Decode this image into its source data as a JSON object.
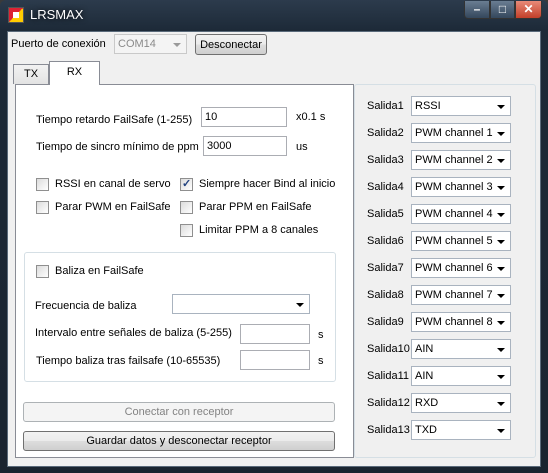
{
  "window": {
    "title": "LRSMAX"
  },
  "connection": {
    "port_label": "Puerto de conexión",
    "port_value": "COM14",
    "disconnect_label": "Desconectar"
  },
  "tabs": [
    {
      "label": "TX"
    },
    {
      "label": "RX"
    }
  ],
  "rx": {
    "failsafe_delay_label": "Tiempo retardo FailSafe (1-255)",
    "failsafe_delay_value": "10",
    "failsafe_delay_unit": "x0.1 s",
    "ppm_sync_label": "Tiempo de sincro mínimo de ppm",
    "ppm_sync_value": "3000",
    "ppm_sync_unit": "us",
    "checkboxes": {
      "rssi_servo": {
        "label": "RSSI en canal de servo",
        "checked": false
      },
      "always_bind": {
        "label": "Siempre hacer Bind al inicio",
        "checked": true
      },
      "stop_pwm_failsafe": {
        "label": "Parar PWM en FailSafe",
        "checked": false
      },
      "stop_ppm_failsafe": {
        "label": "Parar PPM en FailSafe",
        "checked": false
      },
      "limit_ppm_8": {
        "label": "Limitar PPM a 8 canales",
        "checked": false
      }
    },
    "beacon": {
      "enable_label": "Baliza en FailSafe",
      "enable_checked": false,
      "frequency_label": "Frecuencia de baliza",
      "frequency_value": "",
      "interval_label": "Intervalo entre señales de baliza (5-255)",
      "interval_value": "",
      "interval_unit": "s",
      "delay_label": "Tiempo baliza tras failsafe  (10-65535)",
      "delay_value": "",
      "delay_unit": "s"
    },
    "connect_receiver_label": "Conectar con receptor",
    "save_disconnect_label": "Guardar datos y desconectar receptor"
  },
  "outputs": [
    {
      "label": "Salida1",
      "value": "RSSI"
    },
    {
      "label": "Salida2",
      "value": "PWM channel 1"
    },
    {
      "label": "Salida3",
      "value": "PWM channel 2"
    },
    {
      "label": "Salida4",
      "value": "PWM channel 3"
    },
    {
      "label": "Salida5",
      "value": "PWM channel 4"
    },
    {
      "label": "Salida6",
      "value": "PWM channel 5"
    },
    {
      "label": "Salida7",
      "value": "PWM channel 6"
    },
    {
      "label": "Salida8",
      "value": "PWM channel 7"
    },
    {
      "label": "Salida9",
      "value": "PWM channel 8"
    },
    {
      "label": "Salida10",
      "value": "AIN"
    },
    {
      "label": "Salida11",
      "value": "AIN"
    },
    {
      "label": "Salida12",
      "value": "RXD"
    },
    {
      "label": "Salida13",
      "value": "TXD"
    }
  ]
}
